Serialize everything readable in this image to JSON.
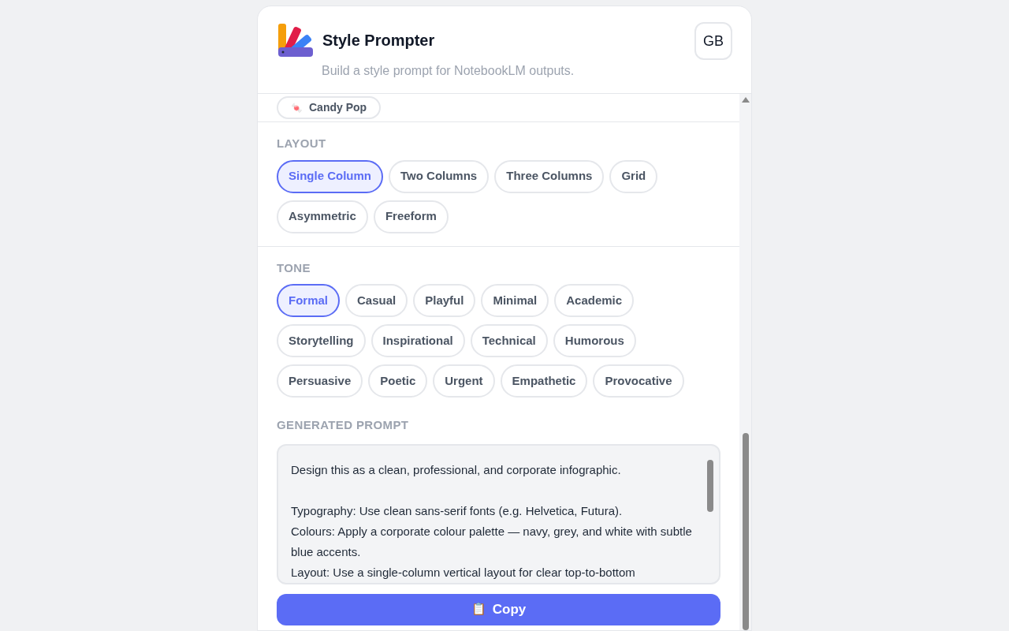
{
  "header": {
    "title": "Style Prompter",
    "subtitle": "Build a style prompt for NotebookLM outputs.",
    "language_button": "GB"
  },
  "style_chip": {
    "label": "Candy Pop",
    "icon": "🍬"
  },
  "sections": [
    {
      "heading": "LAYOUT",
      "options": [
        {
          "label": "Single Column",
          "selected": true
        },
        {
          "label": "Two Columns",
          "selected": false
        },
        {
          "label": "Three Columns",
          "selected": false
        },
        {
          "label": "Grid",
          "selected": false
        },
        {
          "label": "Asymmetric",
          "selected": false
        },
        {
          "label": "Freeform",
          "selected": false
        }
      ]
    },
    {
      "heading": "TONE",
      "options": [
        {
          "label": "Formal",
          "selected": true
        },
        {
          "label": "Casual",
          "selected": false
        },
        {
          "label": "Playful",
          "selected": false
        },
        {
          "label": "Minimal",
          "selected": false
        },
        {
          "label": "Academic",
          "selected": false
        },
        {
          "label": "Storytelling",
          "selected": false
        },
        {
          "label": "Inspirational",
          "selected": false
        },
        {
          "label": "Technical",
          "selected": false
        },
        {
          "label": "Humorous",
          "selected": false
        },
        {
          "label": "Persuasive",
          "selected": false
        },
        {
          "label": "Poetic",
          "selected": false
        },
        {
          "label": "Urgent",
          "selected": false
        },
        {
          "label": "Empathetic",
          "selected": false
        },
        {
          "label": "Provocative",
          "selected": false
        }
      ]
    }
  ],
  "generated_prompt": {
    "heading": "GENERATED PROMPT",
    "text": "Design this as a clean, professional, and corporate infographic.\n\nTypography: Use clean sans-serif fonts (e.g. Helvetica, Futura).\nColours: Apply a corporate colour palette — navy, grey, and white with subtle blue accents.\nLayout: Use a single-column vertical layout for clear top-to-bottom"
  },
  "copy_button": {
    "icon": "📋",
    "label": "Copy"
  }
}
